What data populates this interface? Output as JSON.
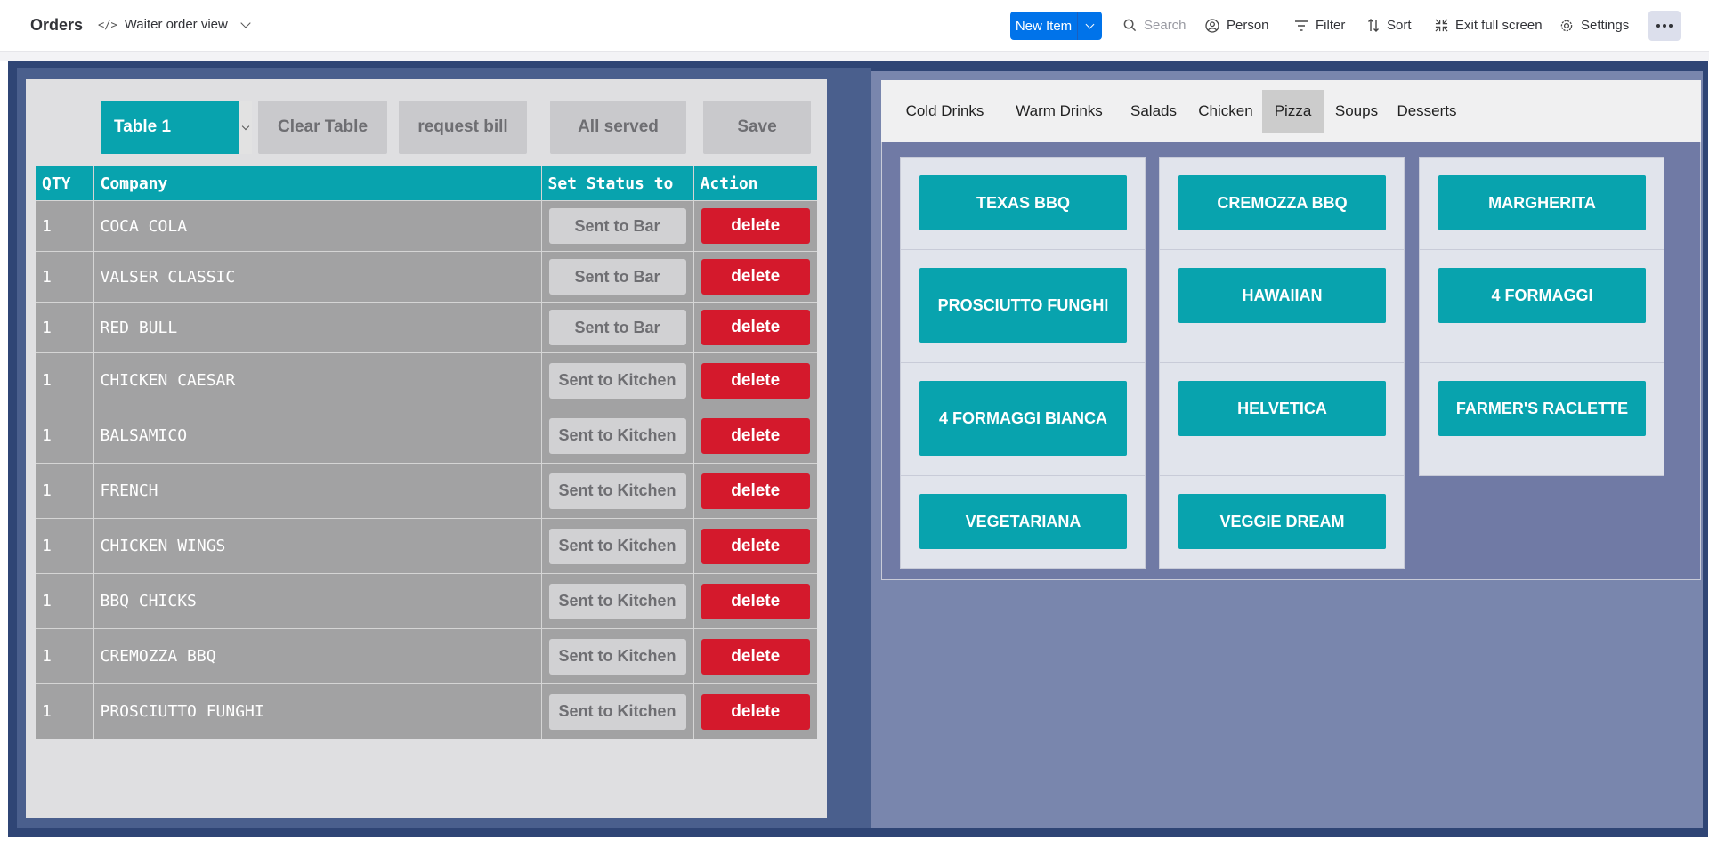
{
  "header": {
    "title": "Orders",
    "view_name": "Waiter order view",
    "new_item_label": "New Item",
    "search_placeholder": "Search",
    "person_label": "Person",
    "filter_label": "Filter",
    "sort_label": "Sort",
    "exit_fullscreen_label": "Exit full screen",
    "settings_label": "Settings"
  },
  "order_panel": {
    "table_selected": "Table 1",
    "buttons": {
      "clear_table": "Clear Table",
      "request_bill": "request bill",
      "all_served": "All served",
      "save": "Save"
    },
    "columns": [
      "QTY",
      "Company",
      "Set Status to",
      "Action"
    ],
    "rows": [
      {
        "qty": "1",
        "item": "COCA COLA",
        "status": "Sent to Bar",
        "action": "delete"
      },
      {
        "qty": "1",
        "item": "VALSER CLASSIC",
        "status": "Sent to Bar",
        "action": "delete"
      },
      {
        "qty": "1",
        "item": "RED BULL",
        "status": "Sent to Bar",
        "action": "delete"
      },
      {
        "qty": "1",
        "item": "CHICKEN CAESAR",
        "status": "Sent to Kitchen",
        "action": "delete"
      },
      {
        "qty": "1",
        "item": "BALSAMICO",
        "status": "Sent to Kitchen",
        "action": "delete"
      },
      {
        "qty": "1",
        "item": "FRENCH",
        "status": "Sent to Kitchen",
        "action": "delete"
      },
      {
        "qty": "1",
        "item": "CHICKEN WINGS",
        "status": "Sent to Kitchen",
        "action": "delete"
      },
      {
        "qty": "1",
        "item": "BBQ CHICKS",
        "status": "Sent to Kitchen",
        "action": "delete"
      },
      {
        "qty": "1",
        "item": "CREMOZZA BBQ",
        "status": "Sent to Kitchen",
        "action": "delete"
      },
      {
        "qty": "1",
        "item": "PROSCIUTTO FUNGHI",
        "status": "Sent to Kitchen",
        "action": "delete"
      }
    ]
  },
  "menu": {
    "categories": [
      "Cold Drinks",
      "Warm Drinks",
      "Salads",
      "Chicken",
      "Pizza",
      "Soups",
      "Desserts"
    ],
    "active_category": "Pizza",
    "columns": [
      [
        "TEXAS BBQ",
        "PROSCIUTTO FUNGHI",
        "4 FORMAGGI BIANCA",
        "VEGETARIANA"
      ],
      [
        "CREMOZZA BBQ",
        "HAWAIIAN",
        "HELVETICA",
        "VEGGIE DREAM"
      ],
      [
        "MARGHERITA",
        "4 FORMAGGI",
        "FARMER'S RACLETTE"
      ]
    ]
  },
  "colors": {
    "accent_teal": "#08a3ae",
    "delete_red": "#d4192c",
    "primary_blue": "#0073ea",
    "board_navy": "#2f4575"
  }
}
